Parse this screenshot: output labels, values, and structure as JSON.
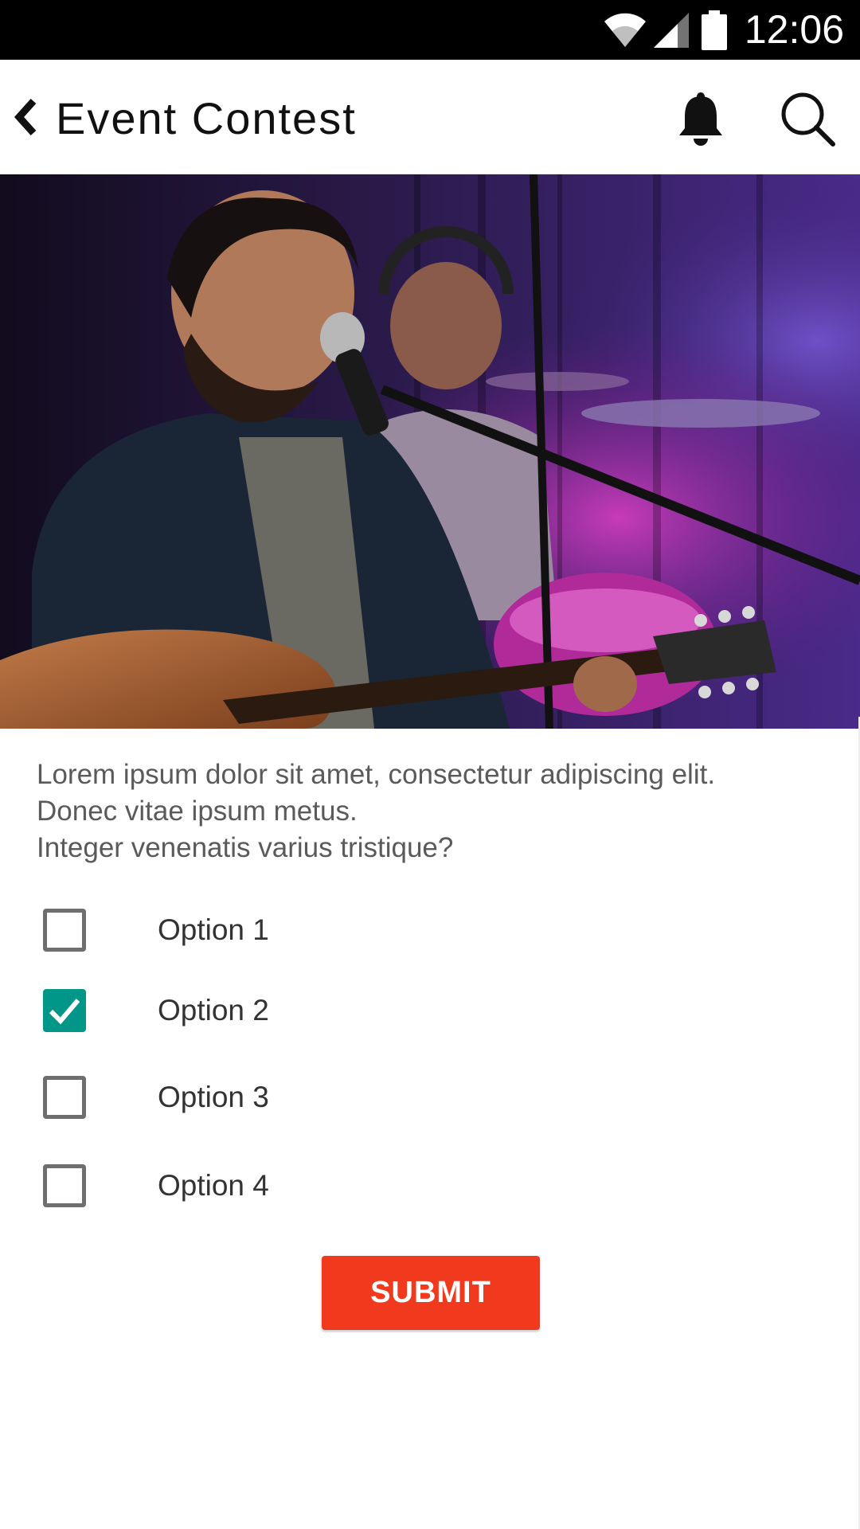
{
  "status_bar": {
    "time": "12:06",
    "icons": [
      "wifi-icon",
      "cell-signal-icon",
      "battery-icon"
    ]
  },
  "app_bar": {
    "back_icon": "chevron-left-icon",
    "title": "Event Contest",
    "actions": [
      "bell-icon",
      "search-icon"
    ]
  },
  "hero": {
    "alt_icon": "concert-photo"
  },
  "question": {
    "lines": [
      "Lorem ipsum dolor sit amet, consectetur adipiscing elit.",
      "Donec vitae ipsum metus.",
      "Integer venenatis varius tristique?"
    ]
  },
  "options": [
    {
      "label": "Option 1",
      "checked": false
    },
    {
      "label": "Option 2",
      "checked": true
    },
    {
      "label": "Option 3",
      "checked": false
    },
    {
      "label": "Option 4",
      "checked": false
    }
  ],
  "submit": {
    "label": "SUBMIT"
  },
  "colors": {
    "accent": "#f0391d",
    "checkbox_checked": "#009688",
    "status_bar": "#000000"
  }
}
